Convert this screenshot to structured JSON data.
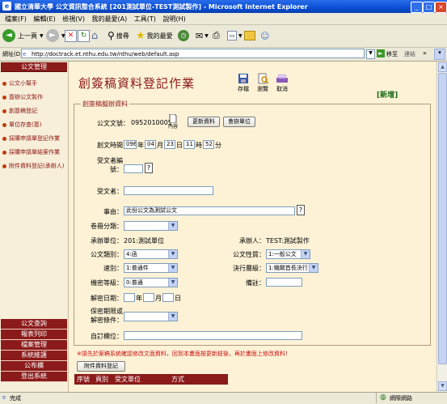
{
  "window": {
    "title": "國立清華大學 公文資訊整合系統 [201測試單位-TEST測試製作] - Microsoft Internet Explorer",
    "icon": "ie-icon"
  },
  "menu": [
    "檔案(F)",
    "編輯(E)",
    "檢視(V)",
    "我的最愛(A)",
    "工具(T)",
    "說明(H)"
  ],
  "toolbar": {
    "back": "上一頁",
    "search": "搜尋",
    "favorites": "我的最愛"
  },
  "address": {
    "label": "網址(D)",
    "url": "http://doctrack.et.nthu.edu.tw/nthu/web/default.asp",
    "go": "移至",
    "links": "連結"
  },
  "sidebar": {
    "header": "公文管理",
    "items": [
      "公文小幫手",
      "簽辦公文製作",
      "創簽稿登記",
      "單位存查(簽)",
      "採購申請單登記作業",
      "採購申請單結案作業",
      "附件資料登記(承辦人)"
    ],
    "bottom": [
      "公文查詢",
      "報表列印",
      "檔案管理",
      "系統維護",
      "公布欄",
      "登出系統"
    ]
  },
  "page": {
    "title": "創簽稿資料登記作業",
    "actions": {
      "save": "存檔",
      "browse": "瀏覽",
      "cancel": "取消"
    },
    "mode": "[新增]",
    "section": "創簽稿擬辦資料"
  },
  "form": {
    "doc_no_label": "公文文號：",
    "doc_no": "0952010005",
    "content_label": "內容",
    "update_btn": "更新資料",
    "sign_btn": "會辦單位",
    "time_label": "創文時間：",
    "time_year": "096",
    "time_year_unit": "年",
    "time_month": "04",
    "time_month_unit": "月",
    "time_day": "23",
    "time_day_unit": "日",
    "time_hour": "11",
    "time_hour_unit": "時",
    "time_min": "52",
    "time_min_unit": "分",
    "recv_no_label_1": "受文者編",
    "recv_no_label_2": "號：",
    "recv_label": "受文者：",
    "subject_label": "事由：",
    "subject": "此份公文為測試公文",
    "category_label": "卷冊分類：",
    "category": "",
    "unit_label": "承辦單位：",
    "unit": "201:測試單位",
    "person_label": "承辦人：",
    "person": "TEST:測試製作",
    "type_label": "公文類別：",
    "type": "4:函",
    "nature_label": "公文性質：",
    "nature": "1:一般公文",
    "speed_label": "速別：",
    "speed": "1:普通件",
    "decision_label": "決行層級：",
    "decision": "1:機關首長決行",
    "secret_label": "機密等級：",
    "secret": "0:普通",
    "note_label": "備註：",
    "declass_label": "解密日期：",
    "declass_year": "年",
    "declass_month": "月",
    "declass_day": "日",
    "keep_label_1": "保密期限或",
    "keep_label_2": "解密條件：",
    "self_label": "自訂欄位：",
    "q": "?"
  },
  "warning": "※請先於案稿系統確認修改文面資料，回到本畫面按更新鈕後，再於畫面上修改資料！",
  "attach_btn": "附件資料登記",
  "attach_table": {
    "headers": [
      "序號",
      "頁別",
      "受文單位",
      "方式"
    ]
  },
  "status": {
    "left": "完成",
    "right": "網際網路"
  },
  "colors": {
    "brand": "#8b1a1a",
    "background": "#fdf2d6",
    "warning": "#c81010",
    "new": "#1a6a1a"
  }
}
